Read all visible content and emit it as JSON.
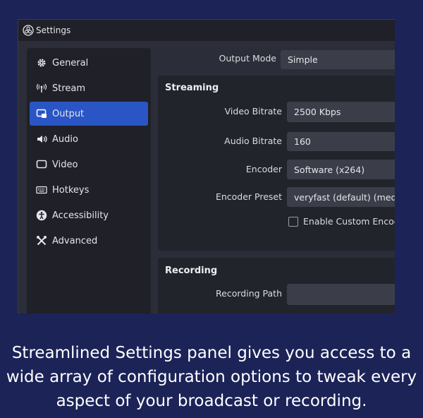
{
  "window": {
    "title": "Settings",
    "logo_icon": "obs-logo-icon"
  },
  "sidebar": {
    "items": [
      {
        "label": "General",
        "icon": "gear-icon",
        "active": false
      },
      {
        "label": "Stream",
        "icon": "antenna-icon",
        "active": false
      },
      {
        "label": "Output",
        "icon": "output-icon",
        "active": true
      },
      {
        "label": "Audio",
        "icon": "speaker-icon",
        "active": false
      },
      {
        "label": "Video",
        "icon": "monitor-icon",
        "active": false
      },
      {
        "label": "Hotkeys",
        "icon": "keyboard-icon",
        "active": false
      },
      {
        "label": "Accessibility",
        "icon": "accessibility-icon",
        "active": false
      },
      {
        "label": "Advanced",
        "icon": "tools-icon",
        "active": false
      }
    ]
  },
  "main": {
    "output_mode": {
      "label": "Output Mode",
      "value": "Simple"
    },
    "streaming": {
      "title": "Streaming",
      "video_bitrate": {
        "label": "Video Bitrate",
        "value": "2500 Kbps"
      },
      "audio_bitrate": {
        "label": "Audio Bitrate",
        "value": "160"
      },
      "encoder": {
        "label": "Encoder",
        "value": "Software (x264)"
      },
      "encoder_preset": {
        "label": "Encoder Preset",
        "value": "veryfast (default) (mediu"
      },
      "custom_encoder": {
        "label": "Enable Custom Encod",
        "checked": false
      }
    },
    "recording": {
      "title": "Recording",
      "recording_path": {
        "label": "Recording Path",
        "value": ""
      }
    }
  },
  "caption": "Streamlined Settings panel gives you access to a wide array of configuration options to tweak every aspect of your broadcast or recording.",
  "colors": {
    "background": "#1b2357",
    "accent": "#2a55c4",
    "window": "#2b2e38"
  }
}
